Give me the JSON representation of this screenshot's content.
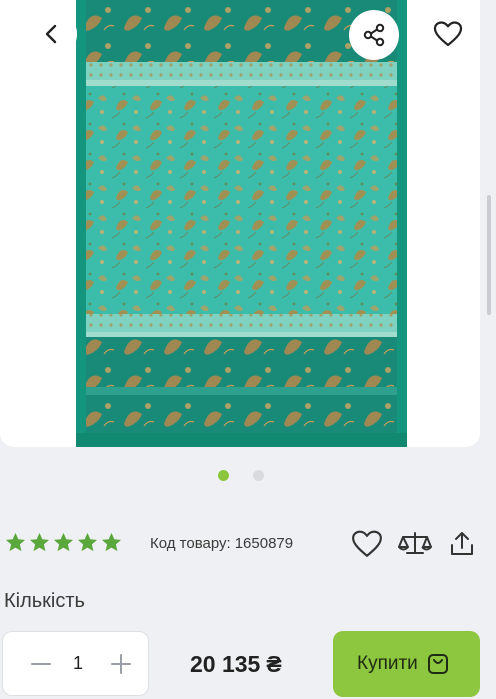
{
  "colors": {
    "accent": "#8dc63f",
    "star": "#5aa83b",
    "fabric_main": "#36b7a6",
    "fabric_border": "#1d8f7a"
  },
  "image": {
    "icons": {
      "back": "chevron-left-icon",
      "share": "share-icon",
      "favorite": "heart-icon"
    },
    "pagination": {
      "total": 2,
      "active": 1
    }
  },
  "product": {
    "rating": 5,
    "code_label": "Код товару:",
    "code_value": "1650879",
    "actions": [
      "heart-icon",
      "compare-scales-icon",
      "upload-icon"
    ]
  },
  "quantity": {
    "label": "Кількість",
    "value": "1",
    "minus": "−",
    "plus": "+"
  },
  "price": {
    "amount": "20 135",
    "currency": "₴"
  },
  "buy": {
    "label": "Купити",
    "icon": "shopping-bag-icon"
  }
}
